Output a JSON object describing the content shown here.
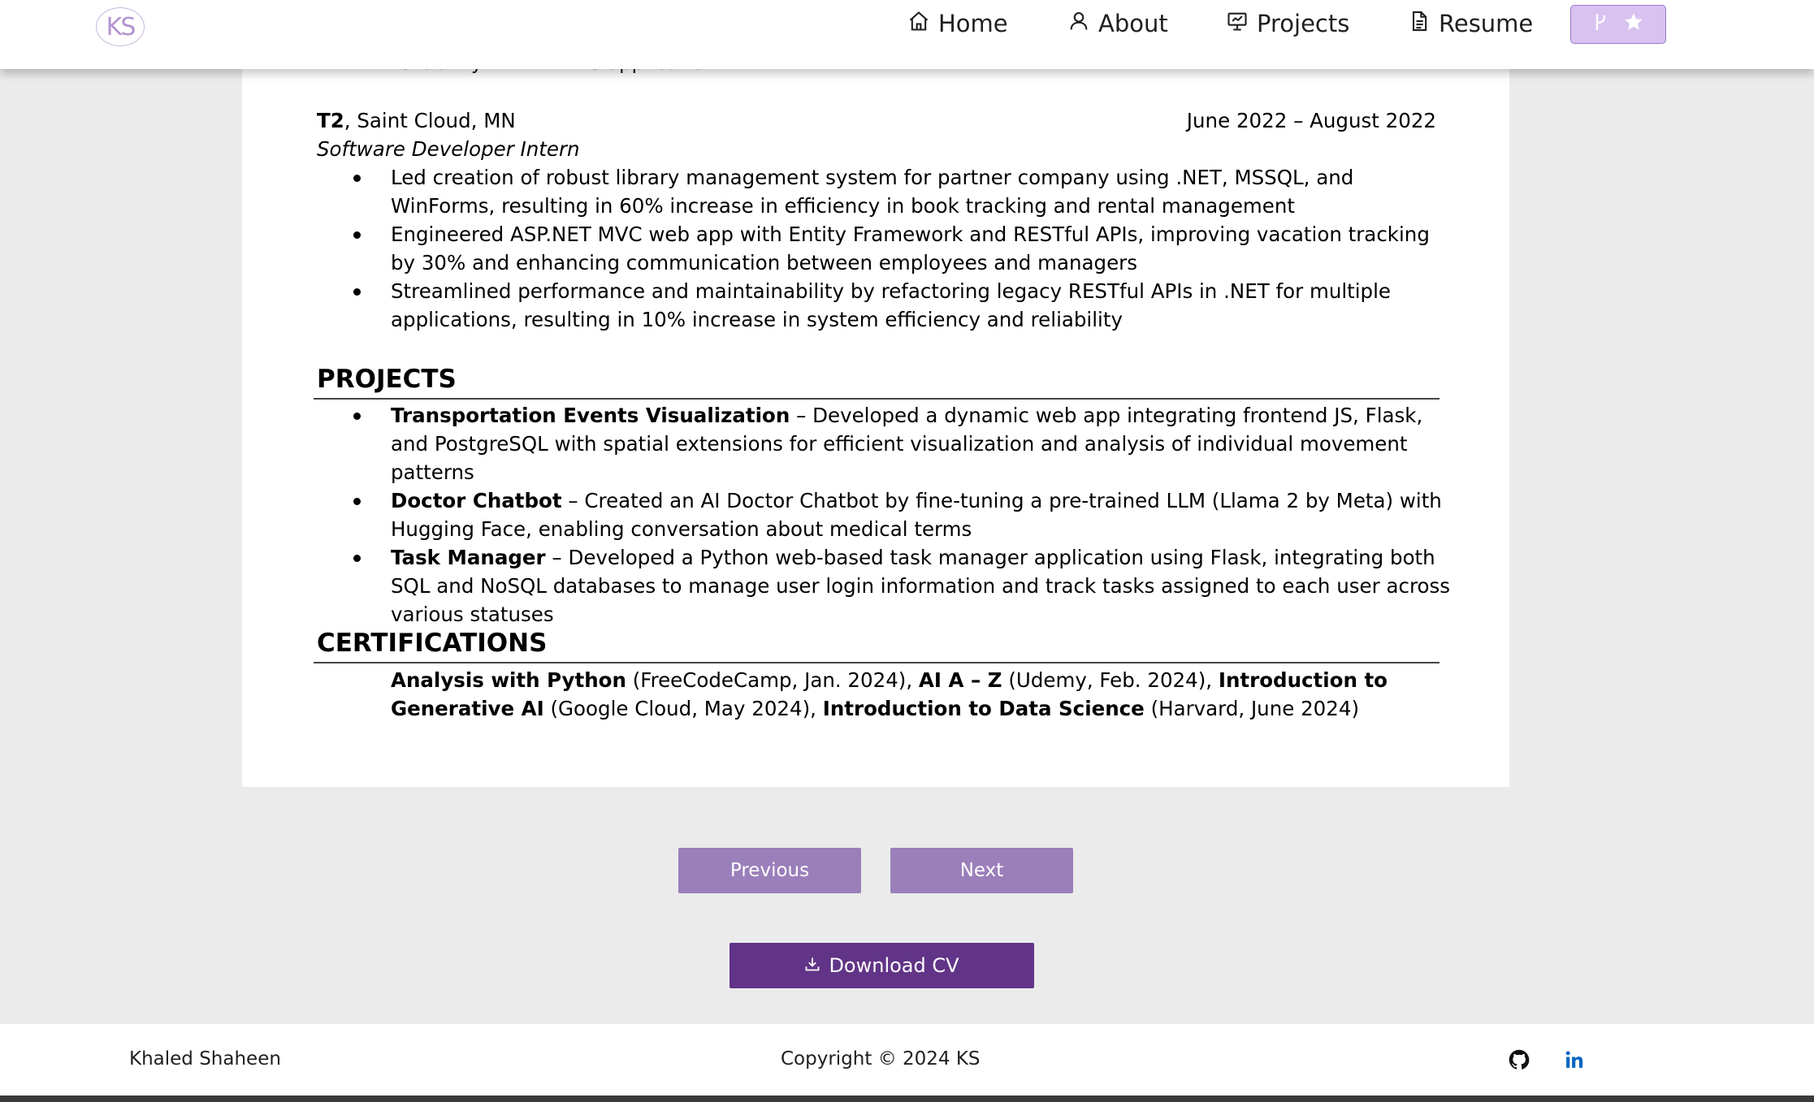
{
  "navbar": {
    "logo_text": "KS",
    "items": [
      {
        "label": "Home",
        "icon": "home-icon"
      },
      {
        "label": "About",
        "icon": "user-icon"
      },
      {
        "label": "Projects",
        "icon": "presentation-icon"
      },
      {
        "label": "Resume",
        "icon": "document-icon"
      }
    ],
    "fork_star_button": {
      "icons": [
        "fork-icon",
        "star-icon"
      ]
    }
  },
  "resume": {
    "cut_off_line": "reliability within MVC application",
    "job": {
      "company": "T2",
      "location": ", Saint Cloud, MN",
      "dates": "June 2022 – August 2022",
      "role": "Software Developer Intern",
      "bullets": [
        "Led creation of robust library management system for partner company using .NET, MSSQL, and WinForms, resulting in 60% increase in efficiency in book tracking and rental management",
        "Engineered ASP.NET MVC web app with Entity Framework and RESTful APIs, improving vacation tracking by 30% and enhancing communication between employees and managers",
        "Streamlined performance and maintainability by refactoring legacy RESTful APIs in .NET for multiple applications, resulting in 10% increase in system efficiency and reliability"
      ]
    },
    "projects": {
      "title": "PROJECTS",
      "items": [
        {
          "name": "Transportation Events Visualization",
          "desc": " – Developed a dynamic web app integrating frontend JS, Flask, and PostgreSQL with spatial extensions for efficient visualization and analysis of individual movement patterns"
        },
        {
          "name": "Doctor Chatbot",
          "desc": " – Created an AI Doctor Chatbot by fine-tuning a pre-trained LLM (Llama 2 by Meta) with Hugging Face, enabling conversation about medical terms"
        },
        {
          "name": "Task Manager",
          "desc": " – Developed a Python web-based task manager application using Flask, integrating both SQL and NoSQL databases to manage user login information and track tasks assigned to each user across various statuses"
        }
      ]
    },
    "certifications": {
      "title": "CERTIFICATIONS",
      "items": [
        {
          "name": "Analysis with Python",
          "detail": " (FreeCodeCamp, Jan. 2024), "
        },
        {
          "name": "AI A – Z",
          "detail": " (Udemy, Feb. 2024), "
        },
        {
          "name": "Introduction to Generative AI",
          "detail": " (Google Cloud, May 2024), "
        },
        {
          "name": "Introduction to Data Science",
          "detail": " (Harvard, June 2024)"
        }
      ]
    }
  },
  "pager": {
    "previous_label": "Previous",
    "next_label": "Next"
  },
  "download": {
    "label": "Download CV",
    "icon": "download-icon"
  },
  "footer": {
    "name": "Khaled Shaheen",
    "copyright": "Copyright © 2024 KS",
    "icons": [
      "github-icon",
      "linkedin-icon"
    ]
  },
  "colors": {
    "accent": "#613487",
    "pager_button": "#9b7fba",
    "logo": "#b393d1",
    "nav_button_bg": "#d8c2f0",
    "page_bg": "#ebebeb",
    "linkedin": "#0a66c2"
  }
}
